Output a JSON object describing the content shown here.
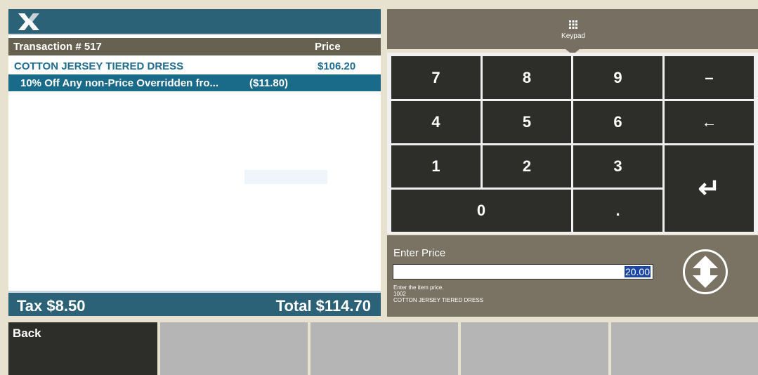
{
  "transaction": {
    "label": "Transaction # 517",
    "price_header": "Price",
    "items": [
      {
        "description": "COTTON JERSEY TIERED DRESS",
        "price": "$106.20"
      },
      {
        "description": "10% Off Any non-Price Overridden fro...",
        "price": "($11.80)"
      }
    ],
    "tax": "Tax $8.50",
    "total": "Total $114.70"
  },
  "keypad": {
    "tab_label": "Keypad",
    "keys": [
      "7",
      "8",
      "9",
      "–",
      "4",
      "5",
      "6",
      "←",
      "1",
      "2",
      "3",
      "↵",
      "0",
      "."
    ]
  },
  "price_entry": {
    "label": "Enter Price",
    "value": "20.00",
    "hint_line_1": "Enter the item price.",
    "hint_line_2": "1002",
    "hint_line_3": "COTTON JERSEY TIERED DRESS"
  },
  "bottom": {
    "back_label": "Back"
  },
  "colors": {
    "accent_teal": "#2b6277",
    "header_brown": "#666150",
    "key_dark": "#2d2d29",
    "selection_blue": "#1a6a8a"
  }
}
